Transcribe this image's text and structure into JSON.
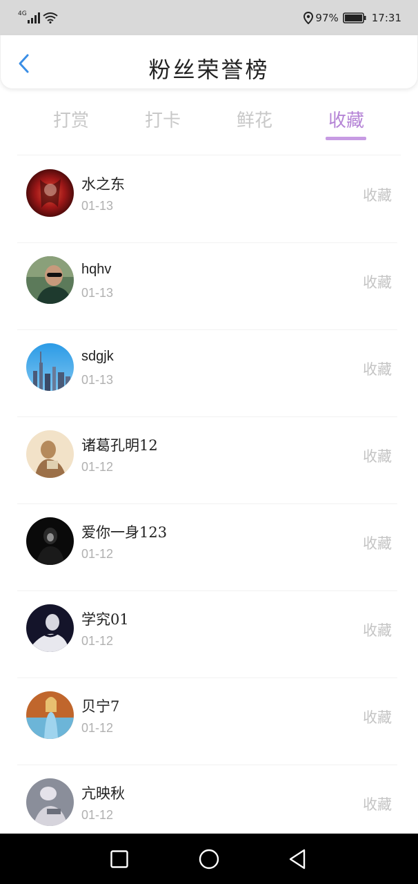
{
  "status_bar": {
    "network": "4G",
    "battery": "97%",
    "time": "17:31",
    "icons": [
      "signal-icon",
      "wifi-icon",
      "location-icon",
      "battery-icon"
    ]
  },
  "header": {
    "title": "粉丝荣誉榜",
    "back_icon": "back-chevron-icon",
    "accent_color": "#3a8ee6"
  },
  "tabs": [
    {
      "label": "打赏",
      "active": false
    },
    {
      "label": "打卡",
      "active": false
    },
    {
      "label": "鲜花",
      "active": false
    },
    {
      "label": "收藏",
      "active": true
    }
  ],
  "active_tab_color": "#b584d6",
  "fans": [
    {
      "name": "水之东",
      "date": "01-13",
      "action": "收藏"
    },
    {
      "name": "hqhv",
      "date": "01-13",
      "action": "收藏"
    },
    {
      "name": "sdgjk",
      "date": "01-13",
      "action": "收藏"
    },
    {
      "name": "诸葛孔明12",
      "date": "01-12",
      "action": "收藏"
    },
    {
      "name": "爱你一身123",
      "date": "01-12",
      "action": "收藏"
    },
    {
      "name": "学究01",
      "date": "01-12",
      "action": "收藏"
    },
    {
      "name": "贝宁7",
      "date": "01-12",
      "action": "收藏"
    },
    {
      "name": "亢映秋",
      "date": "01-12",
      "action": "收藏"
    }
  ],
  "nav_bar": {
    "icons": [
      "recent-apps-icon",
      "home-icon",
      "back-icon"
    ]
  }
}
